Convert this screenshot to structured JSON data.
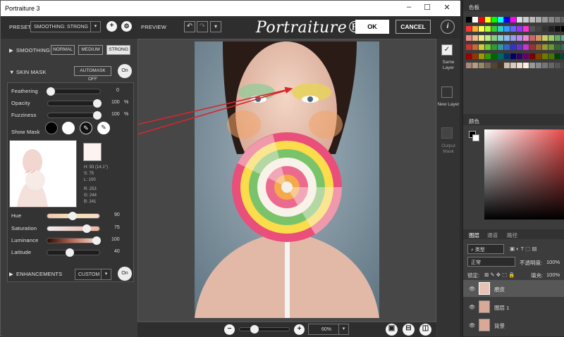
{
  "window": {
    "title": "Portraiture 3",
    "min": "–",
    "max": "☐",
    "close": "✕"
  },
  "toolbar": {
    "preset_label": "PRESET",
    "preset_value": "SMOOTHING: STRONG",
    "add": "+",
    "gear": "⚙",
    "preview_label": "PREVIEW",
    "logo": "Portraiture® 3",
    "ok": "OK",
    "cancel": "CANCEL",
    "info": "i"
  },
  "smoothing": {
    "label": "SMOOTHING",
    "normal": "NORMAL",
    "medium": "MEDIUM",
    "strong": "STRONG"
  },
  "skin_mask": {
    "label": "SKIN MASK",
    "automask": "AUTOMASK OFF",
    "toggle": "On",
    "feathering": {
      "label": "Feathering",
      "value": "0",
      "pct": 0
    },
    "opacity": {
      "label": "Opacity",
      "value": "100",
      "unit": "%",
      "pct": 1
    },
    "fuzziness": {
      "label": "Fuzziness",
      "value": "100",
      "unit": "%",
      "pct": 1
    },
    "show_mask": "Show Mask",
    "color_info": {
      "h": "H: 93 (14.1°)",
      "s": "S:  75",
      "l": "L: 100",
      "r": "R: 253",
      "g": "G: 244",
      "b": "B: 241"
    },
    "hue": {
      "label": "Hue",
      "value": "90",
      "pct": 0.52
    },
    "saturation": {
      "label": "Saturation",
      "value": "75",
      "pct": 0.75
    },
    "luminance": {
      "label": "Luminance",
      "value": "100",
      "pct": 1
    },
    "latitude": {
      "label": "Latitude",
      "value": "40",
      "pct": 0.4
    }
  },
  "enhancements": {
    "label": "ENHANCEMENTS",
    "preset": "CUSTOM",
    "toggle": "On"
  },
  "right_tools": {
    "same": "Same Layer",
    "new": "New Layer",
    "output": "Output Mask"
  },
  "bottom": {
    "zoom": "60%",
    "minus": "−",
    "plus": "+"
  },
  "photoshop": {
    "swatches_tab": "色板",
    "color_tab": "颜色",
    "layers_tab": "图层",
    "channels_tab": "通道",
    "paths_tab": "路径",
    "kind": "类型",
    "blend": "正常",
    "opacity_label": "不透明度:",
    "opacity": "100%",
    "lock_label": "锁定:",
    "fill_label": "填充:",
    "fill": "100%",
    "layers": [
      "磨皮",
      "图层 1",
      "背景"
    ]
  }
}
